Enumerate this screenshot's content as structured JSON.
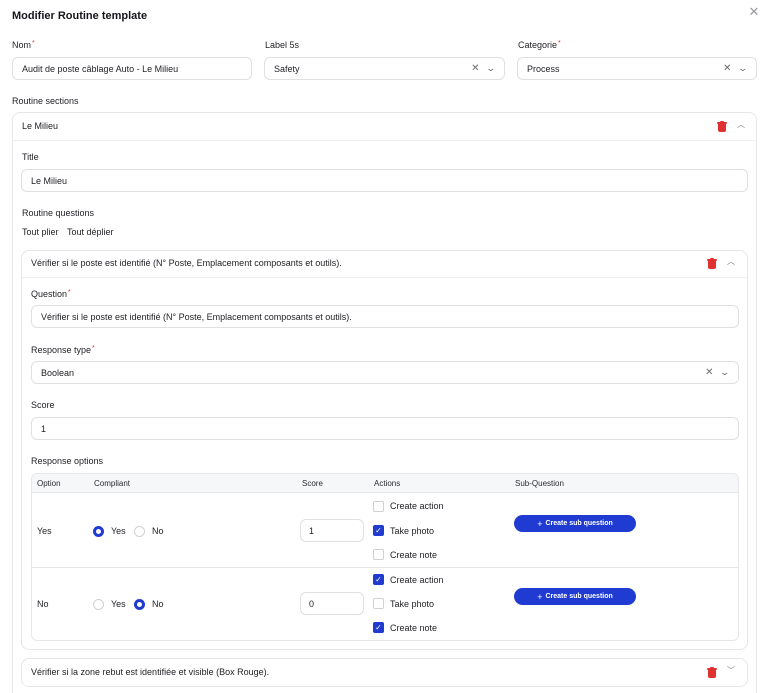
{
  "dialog": {
    "title": "Modifier Routine template"
  },
  "form": {
    "nom": {
      "label": "Nom",
      "value": "Audit de poste câblage Auto - Le Milieu"
    },
    "label5s": {
      "label": "Label 5s",
      "value": "Safety"
    },
    "categorie": {
      "label": "Categorie",
      "value": "Process"
    }
  },
  "sections": {
    "heading": "Routine sections",
    "section": {
      "header": "Le Milieu",
      "title_label": "Title",
      "title_value": "Le Milieu",
      "questions_label": "Routine questions",
      "collapse_all": "Tout plier",
      "expand_all": "Tout déplier"
    }
  },
  "question1": {
    "header": "Vérifier si le poste est identifié (N° Poste, Emplacement composants et outils).",
    "question_label": "Question",
    "question_value": "Vérifier si le poste est identifié (N° Poste, Emplacement composants et outils).",
    "response_type_label": "Response type",
    "response_type_value": "Boolean",
    "score_label": "Score",
    "score_value": "1",
    "options_label": "Response options",
    "columns": {
      "option": "Option",
      "compliant": "Compliant",
      "score": "Score",
      "actions": "Actions",
      "subquestion": "Sub-Question"
    },
    "radio_labels": {
      "yes": "Yes",
      "no": "No"
    },
    "action_labels": {
      "create_action": "Create action",
      "take_photo": "Take photo",
      "create_note": "Create note"
    },
    "sub_button_label": "Create sub question",
    "rows": [
      {
        "option": "Yes",
        "compliant": "yes",
        "score": "1",
        "create_action": false,
        "take_photo": true,
        "create_note": false
      },
      {
        "option": "No",
        "compliant": "no",
        "score": "0",
        "create_action": true,
        "take_photo": false,
        "create_note": true
      }
    ]
  },
  "question2": {
    "header": "Vérifier si la zone rebut est identifiée et visible (Box Rouge)."
  },
  "colors": {
    "accent": "#1f3bd1",
    "danger": "#e03131",
    "border": "#e6e7ea"
  }
}
